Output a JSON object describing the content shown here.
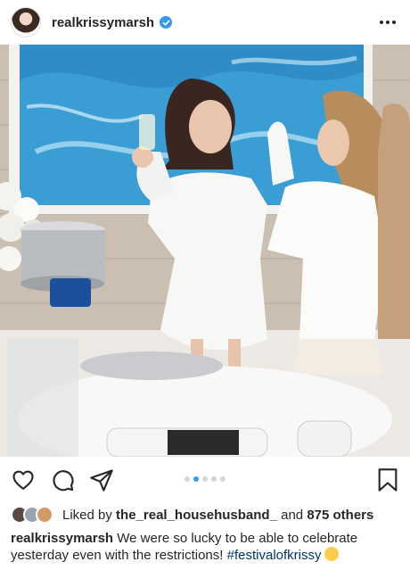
{
  "post": {
    "username": "realkrissymarsh",
    "verified_icon": "verified-badge-icon",
    "more_icon": "more-options-icon",
    "carousel": {
      "total": 5,
      "active_index": 1
    },
    "liked_by_prefix": "Liked by",
    "liked_by_user": "the_real_househusband_",
    "liked_and": "and",
    "liked_others": "875 others",
    "caption_user": "realkrissymarsh",
    "caption_text": "We were so lucky to be able to celebrate yesterday even with the restrictions!",
    "caption_hashtag": "#festivalofkrissy",
    "caption_emoji": "rolling-on-floor-laughing-emoji"
  },
  "colors": {
    "accent_blue": "#3897f0",
    "text": "#262626",
    "hashtag": "#003569"
  },
  "icons": [
    "heart-icon",
    "comment-icon",
    "share-icon",
    "save-icon"
  ]
}
